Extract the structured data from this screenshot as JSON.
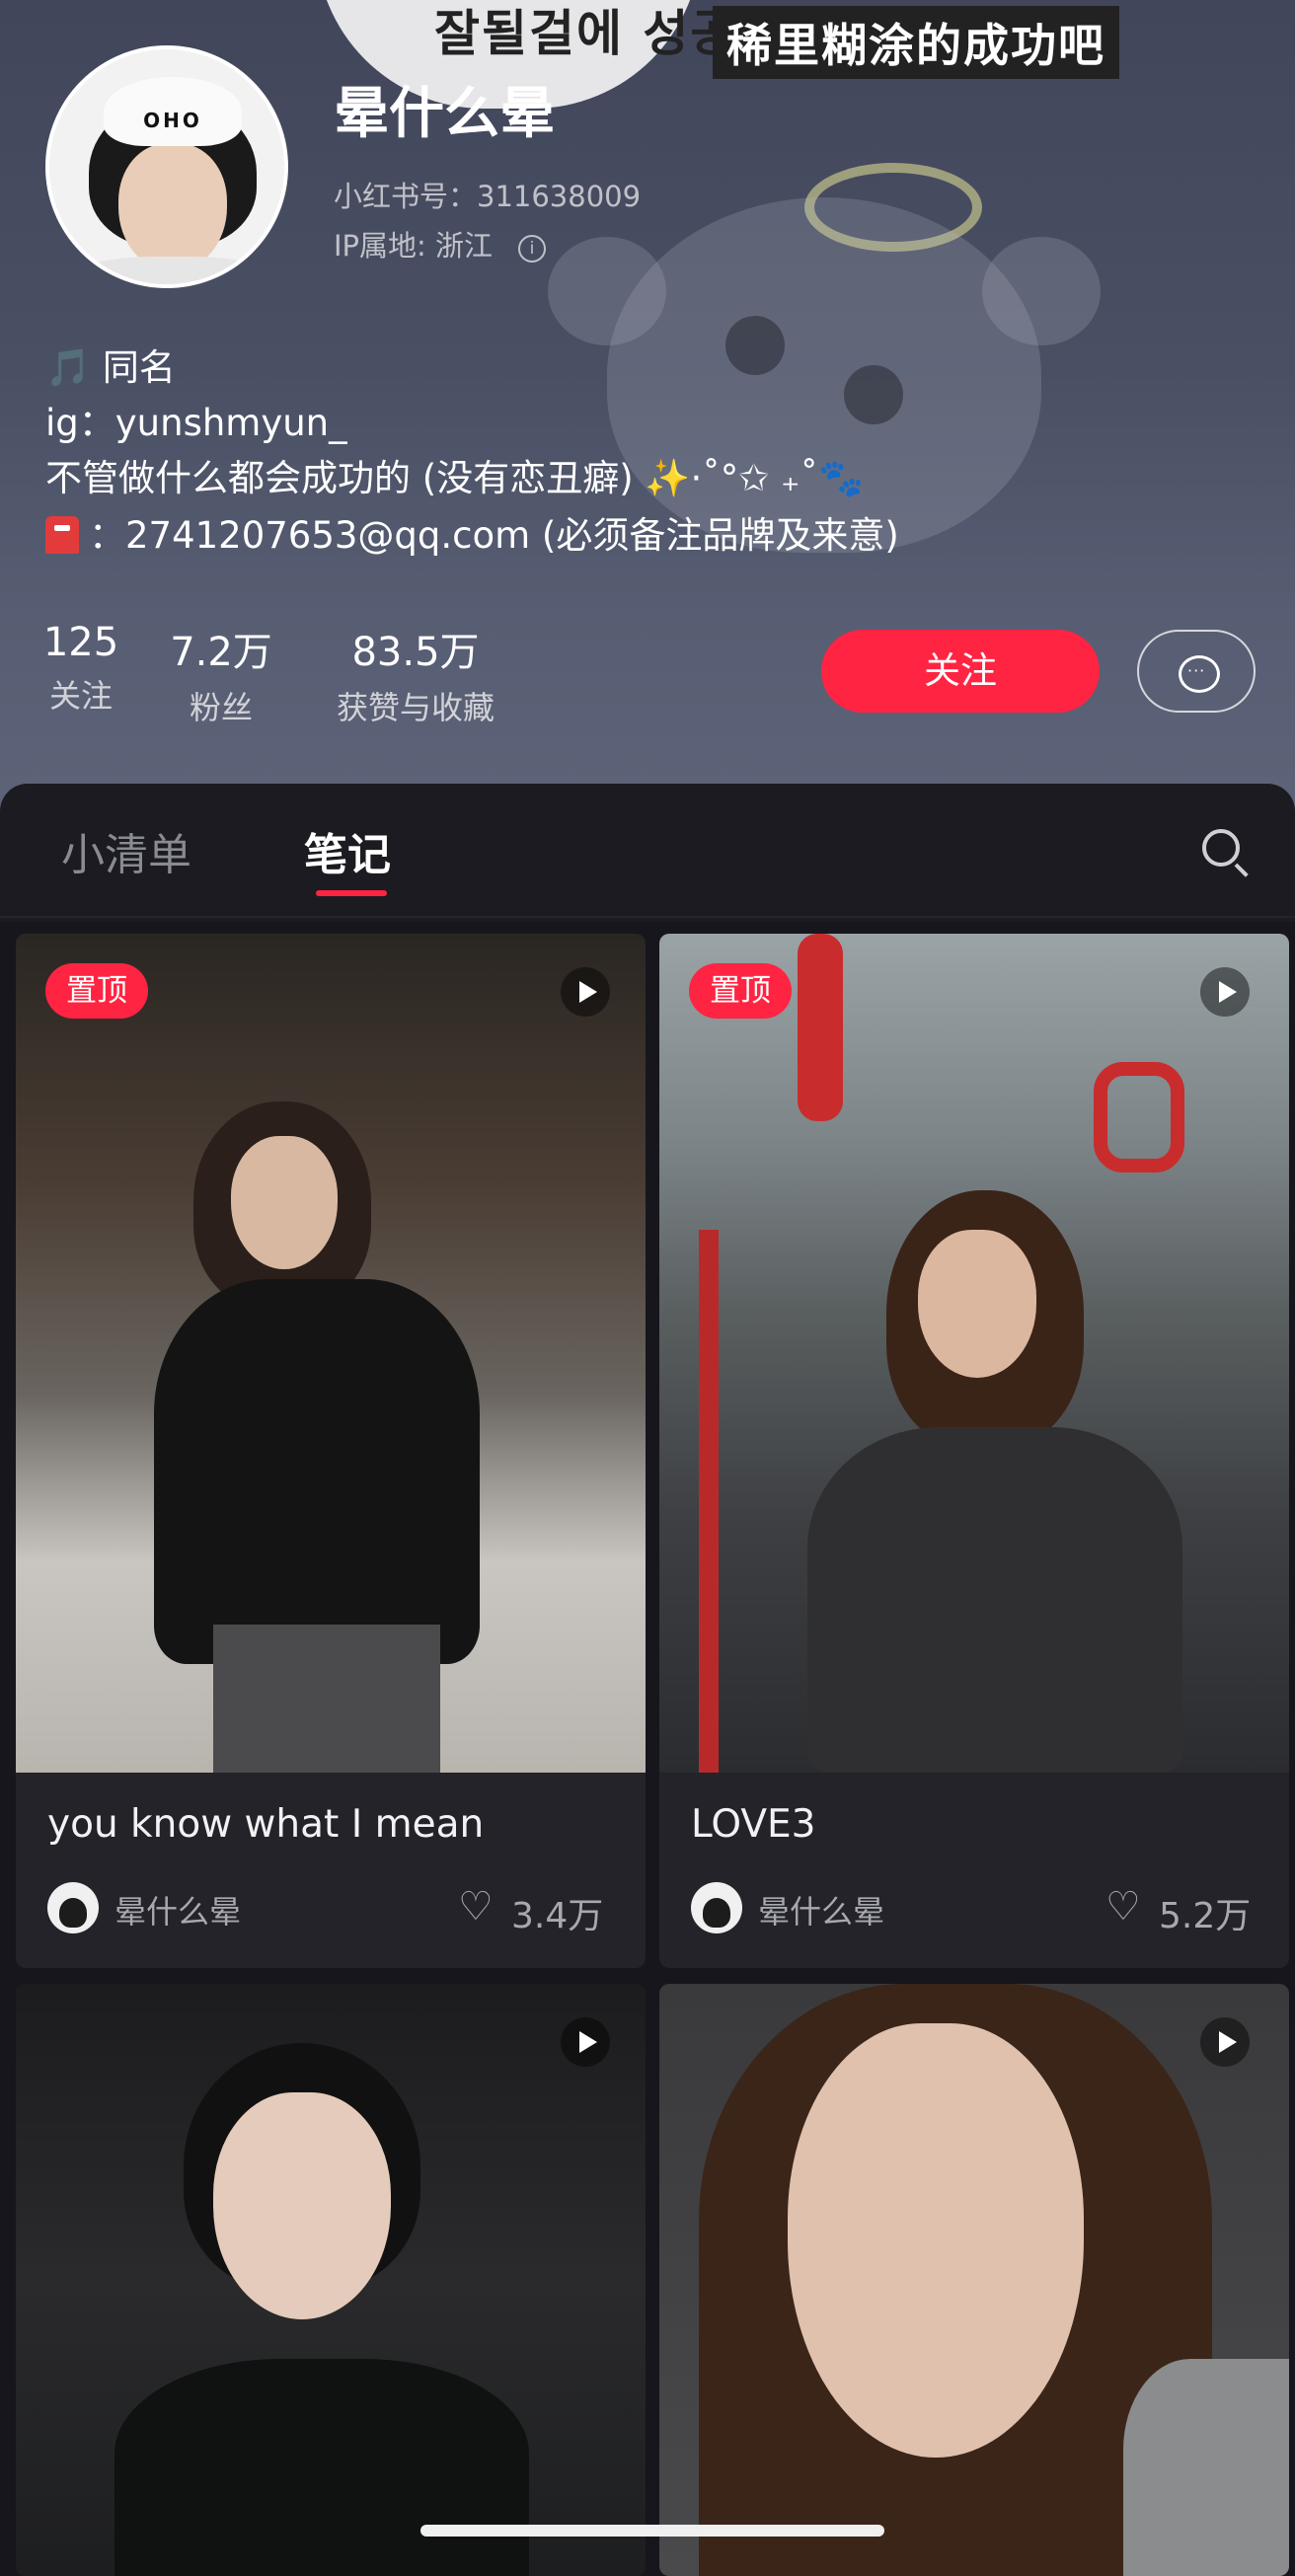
{
  "background": {
    "speech_text": "잘될걸에 성공하세용",
    "tag_text": "稀里糊涂的成功吧"
  },
  "profile": {
    "avatar_cap_text": "OHO",
    "name": "晕什么晕",
    "id_line": "小红书号：311638009",
    "ip_line": "IP属地: 浙江",
    "bio": [
      "🎵 同名",
      "ig：yunshmyun_",
      "不管做什么都会成功的 (没有恋丑癖) ✨·˚°✩ ₊˚🐾",
      "：2741207653@qq.com (必须备注品牌及来意)"
    ],
    "stats": [
      {
        "value": "125",
        "label": "关注"
      },
      {
        "value": "7.2万",
        "label": "粉丝"
      },
      {
        "value": "83.5万",
        "label": "获赞与收藏"
      }
    ],
    "follow_label": "关注"
  },
  "tabs": {
    "items": [
      {
        "label": "小清单"
      },
      {
        "label": "笔记"
      }
    ],
    "active": "笔记"
  },
  "feed": {
    "cards": [
      {
        "pinned_label": "置顶",
        "title": "you know what I mean",
        "author": "晕什么晕",
        "likes": "3.4万"
      },
      {
        "pinned_label": "置顶",
        "title": "LOVE3",
        "author": "晕什么晕",
        "likes": "5.2万"
      },
      {},
      {}
    ]
  },
  "colors": {
    "accent": "#ff2442",
    "panel": "#1b1b21",
    "card": "#232329"
  }
}
